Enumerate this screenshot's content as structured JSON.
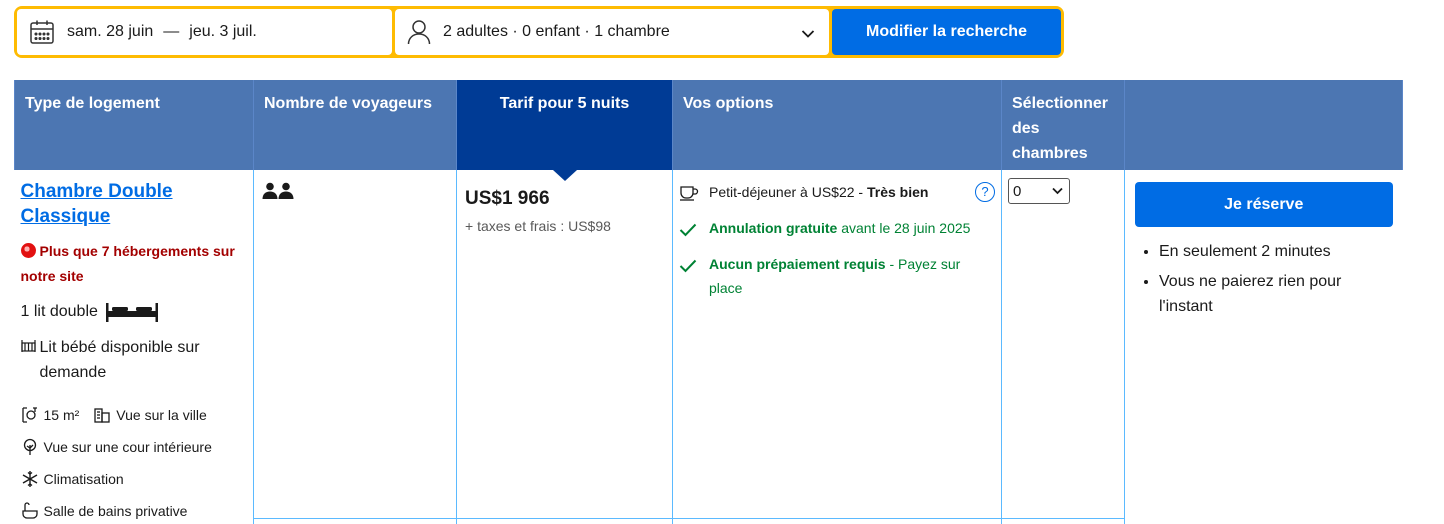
{
  "search": {
    "checkin": "sam. 28 juin",
    "separator": "—",
    "checkout": "jeu. 3 juil.",
    "guests": "2 adultes · 0 enfant · 1 chambre",
    "button": "Modifier la recherche"
  },
  "table": {
    "headers": [
      "Type de logement",
      "Nombre de voyageurs",
      "Tarif pour 5 nuits",
      "Vos options",
      "Sélectionner des chambres",
      ""
    ],
    "room": {
      "name": "Chambre Double Classique",
      "scarcity": "Plus que 7 hébergements sur notre site",
      "bed": "1 lit double",
      "crib": "Lit bébé disponible sur demande",
      "size": "15 m²",
      "view_city": "Vue sur la ville",
      "view_courtyard": "Vue sur une cour intérieure",
      "aircon": "Climatisation",
      "bathroom": "Salle de bains privative"
    },
    "price": "US$1 966",
    "taxes": "+ taxes et frais : US$98",
    "options": {
      "breakfast_text": "Petit-déjeuner à US$22 - ",
      "breakfast_rating": "Très bien",
      "cancel_bold": "Annulation gratuite",
      "cancel_rest": " avant le 28 juin 2025",
      "prepay_bold": "Aucun prépaiement requis",
      "prepay_rest": " - Payez sur place",
      "help": "?"
    },
    "select_value": "0",
    "reserve_button": "Je réserve",
    "benefits": [
      "En seulement 2 minutes",
      "Vous ne paierez rien pour l'instant"
    ]
  }
}
